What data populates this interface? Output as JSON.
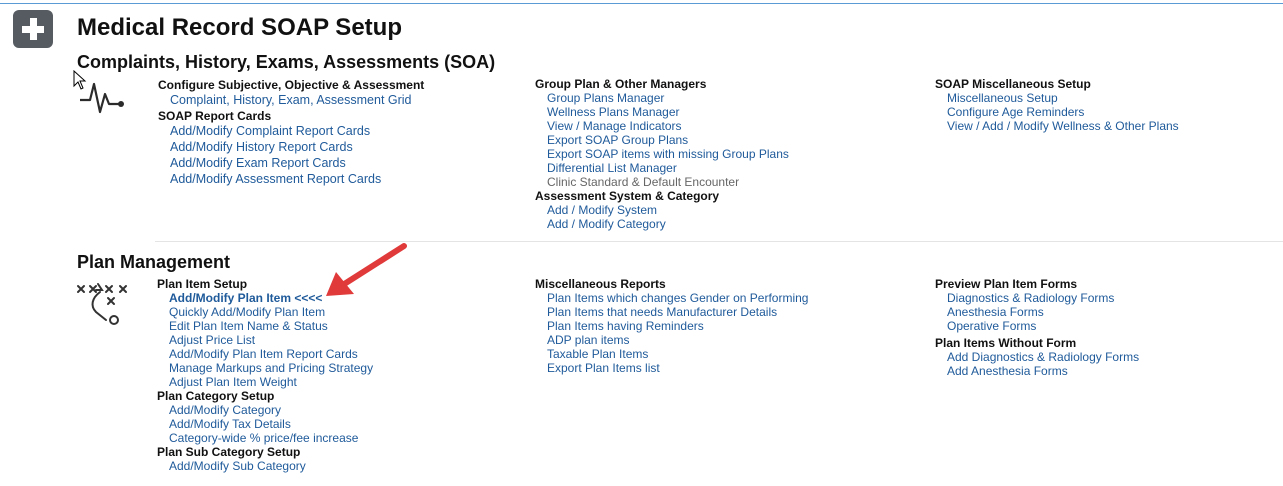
{
  "title": "Medical Record SOAP Setup",
  "icons": {
    "add": "plus-icon",
    "soa": "heartbeat-icon",
    "plan": "strategy-play-icon"
  },
  "colors": {
    "link": "#1f5a9a",
    "accent_arrow": "#e03a3a",
    "top_border": "#5b9bd5"
  },
  "soa_section": {
    "title": "Complaints, History, Exams, Assessments (SOA)",
    "col1": {
      "configure_title": "Configure Subjective, Objective & Assessment",
      "configure_link": "Complaint, History, Exam, Assessment Grid",
      "report_title": "SOAP Report Cards",
      "report_links": [
        "Add/Modify Complaint Report Cards",
        "Add/Modify History Report Cards",
        "Add/Modify Exam Report Cards",
        "Add/Modify Assessment Report Cards"
      ]
    },
    "col2": {
      "group_title": "Group Plan & Other Managers",
      "group_links": [
        "Group Plans Manager",
        "Wellness Plans Manager",
        "View / Manage Indicators",
        "Export SOAP Group Plans",
        "Export SOAP items with missing Group Plans",
        "Differential List Manager",
        "Clinic Standard & Default Encounter"
      ],
      "assess_title": "Assessment System & Category",
      "assess_links": [
        "Add / Modify System",
        "Add / Modify Category"
      ]
    },
    "col3": {
      "misc_title": "SOAP Miscellaneous Setup",
      "misc_links": [
        "Miscellaneous Setup",
        "Configure Age Reminders",
        "View / Add / Modify Wellness & Other Plans"
      ]
    }
  },
  "plan_section": {
    "title": "Plan Management",
    "col1": {
      "item_title": "Plan Item Setup",
      "item_links": [
        "Add/Modify Plan Item <<<<",
        "Quickly Add/Modify Plan Item",
        "Edit Plan Item Name & Status",
        "Adjust Price List",
        "Add/Modify Plan Item Report Cards",
        "Manage Markups and Pricing Strategy",
        "Adjust Plan Item Weight"
      ],
      "category_title": "Plan Category Setup",
      "category_links": [
        "Add/Modify Category",
        "Add/Modify Tax Details",
        "Category-wide % price/fee increase"
      ],
      "subcat_title": "Plan Sub Category Setup",
      "subcat_links": [
        "Add/Modify Sub Category"
      ]
    },
    "col2": {
      "misc_title": "Miscellaneous Reports",
      "misc_links": [
        "Plan Items which changes Gender on Performing",
        "Plan Items that needs Manufacturer Details",
        "Plan Items having Reminders",
        "ADP plan items",
        "Taxable Plan Items",
        "Export Plan Items list"
      ]
    },
    "col3": {
      "preview_title": "Preview Plan Item Forms",
      "preview_links": [
        "Diagnostics & Radiology Forms",
        "Anesthesia Forms",
        "Operative Forms"
      ],
      "noform_title": "Plan Items Without Form",
      "noform_links": [
        "Add Diagnostics & Radiology Forms",
        "Add Anesthesia Forms"
      ]
    }
  }
}
